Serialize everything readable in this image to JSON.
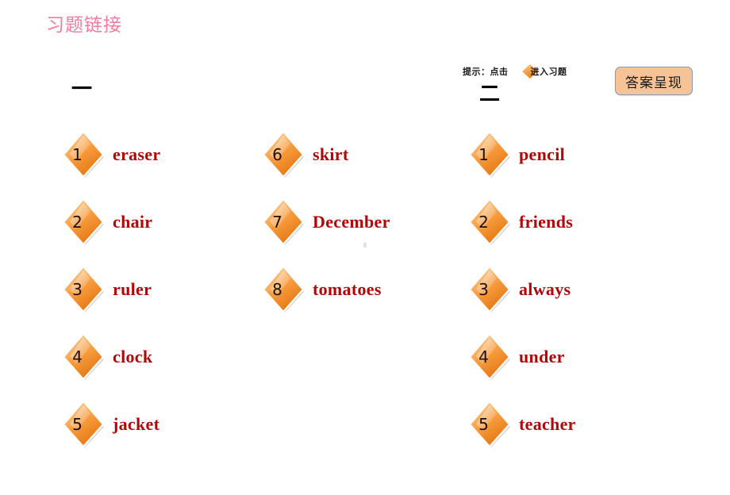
{
  "page": {
    "title": "习题链接",
    "title_color": "#f47a9c",
    "background": "#ffffff"
  },
  "hint": {
    "prefix": "提示：点击",
    "suffix": "进入习题",
    "icon": "diamond-icon"
  },
  "answer_button": {
    "label": "答案呈现",
    "fill": "#f5c396",
    "border": "#8a9bb5"
  },
  "sections": [
    {
      "heading": "一",
      "id": "section-one"
    },
    {
      "heading": "二",
      "id": "section-two"
    }
  ],
  "theme": {
    "diamond_light": "#fbbe7a",
    "diamond_mid": "#f79a3c",
    "diamond_dark": "#e8801c",
    "word_color": "#b00808",
    "number_color": "#1d1008"
  },
  "columns": [
    {
      "id": "column-one",
      "items": [
        {
          "number": "1",
          "word": "eraser"
        },
        {
          "number": "2",
          "word": "chair"
        },
        {
          "number": "3",
          "word": "ruler"
        },
        {
          "number": "4",
          "word": "clock"
        },
        {
          "number": "5",
          "word": "jacket"
        }
      ]
    },
    {
      "id": "column-two",
      "items": [
        {
          "number": "6",
          "word": "skirt"
        },
        {
          "number": "7",
          "word": "December"
        },
        {
          "number": "8",
          "word": "tomatoes"
        }
      ]
    },
    {
      "id": "column-three",
      "items": [
        {
          "number": "1",
          "word": "pencil"
        },
        {
          "number": "2",
          "word": "friends"
        },
        {
          "number": "3",
          "word": "always"
        },
        {
          "number": "4",
          "word": "under"
        },
        {
          "number": "5",
          "word": "teacher"
        }
      ]
    }
  ]
}
